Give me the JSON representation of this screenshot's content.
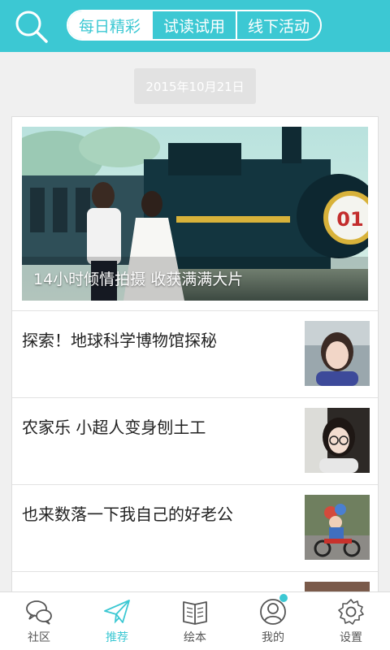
{
  "header": {
    "search_icon": "search-icon",
    "tabs": [
      {
        "label": "每日精彩",
        "active": true
      },
      {
        "label": "试读试用",
        "active": false
      },
      {
        "label": "线下活动",
        "active": false
      }
    ]
  },
  "feed": {
    "date": "2015年10月21日",
    "hero": {
      "caption": "14小时倾情拍摄  收获满满大片",
      "photo_text": "01"
    },
    "items": [
      {
        "title": "探索！地球科学博物馆探秘"
      },
      {
        "title": "农家乐  小超人变身刨土工"
      },
      {
        "title": "也来数落一下我自己的好老公"
      }
    ]
  },
  "nav": {
    "items": [
      {
        "label": "社区",
        "icon": "chat-bubbles-icon",
        "active": false
      },
      {
        "label": "推荐",
        "icon": "paper-plane-icon",
        "active": true
      },
      {
        "label": "绘本",
        "icon": "book-icon",
        "active": false
      },
      {
        "label": "我的",
        "icon": "person-icon",
        "active": false,
        "badge": true
      },
      {
        "label": "设置",
        "icon": "gear-icon",
        "active": false
      }
    ]
  },
  "colors": {
    "accent": "#3cc8d3"
  }
}
